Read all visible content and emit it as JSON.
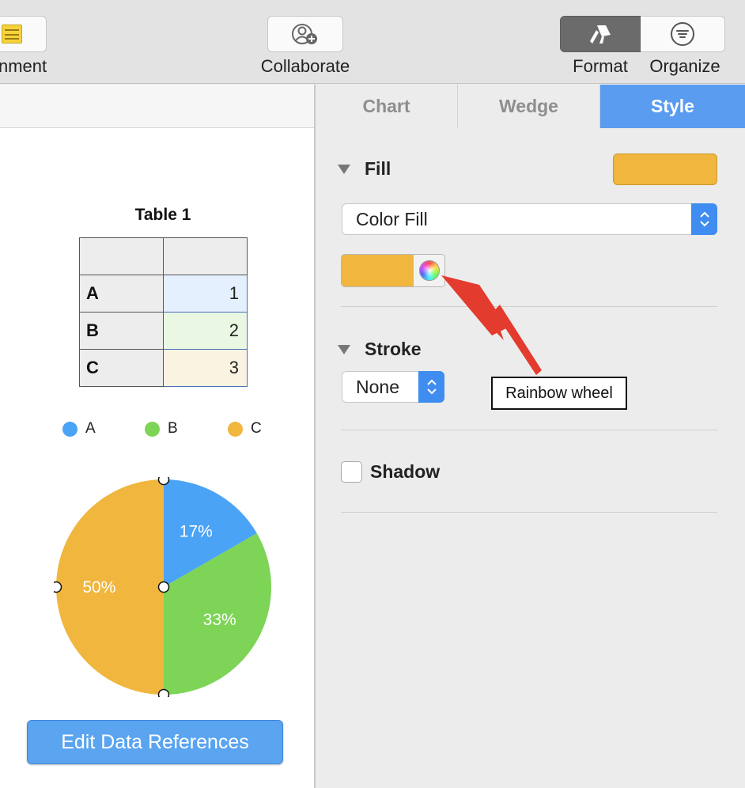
{
  "toolbar": {
    "comment_label": "nment",
    "collaborate_label": "Collaborate",
    "format_label": "Format",
    "organize_label": "Organize"
  },
  "table": {
    "title": "Table 1",
    "rows": [
      {
        "label": "A",
        "value": "1",
        "color": "#e4f0fd"
      },
      {
        "label": "B",
        "value": "2",
        "color": "#e9f7e3"
      },
      {
        "label": "C",
        "value": "3",
        "color": "#fbf3e1"
      }
    ]
  },
  "legend": [
    {
      "label": "A",
      "color": "#4aa3f5"
    },
    {
      "label": "B",
      "color": "#7dd456"
    },
    {
      "label": "C",
      "color": "#f0b63d"
    }
  ],
  "chart_data": {
    "type": "pie",
    "categories": [
      "A",
      "B",
      "C"
    ],
    "values": [
      1,
      2,
      3
    ],
    "labels": [
      "17%",
      "33%",
      "50%"
    ],
    "colors": [
      "#4aa3f5",
      "#7dd456",
      "#f0b63d"
    ]
  },
  "edit_button": "Edit Data References",
  "inspector": {
    "tabs": [
      {
        "label": "Chart",
        "active": false
      },
      {
        "label": "Wedge",
        "active": false
      },
      {
        "label": "Style",
        "active": true
      }
    ],
    "fill": {
      "title": "Fill",
      "swatch_color": "#f0b63d",
      "type_value": "Color Fill"
    },
    "stroke": {
      "title": "Stroke",
      "value": "None"
    },
    "shadow": {
      "title": "Shadow",
      "checked": false
    },
    "callout": "Rainbow wheel"
  }
}
